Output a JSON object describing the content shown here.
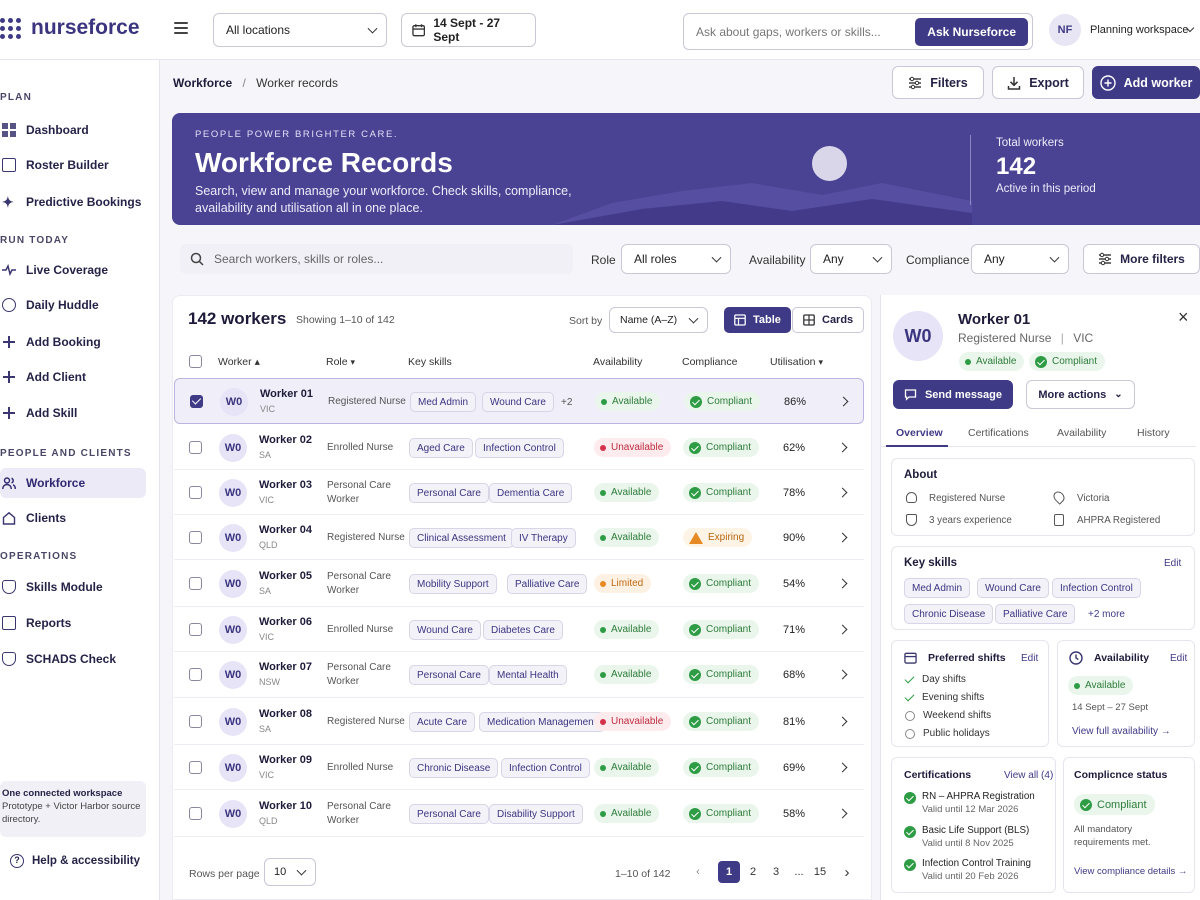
{
  "app": {
    "brand": "nurseforce",
    "workspace": "Planning workspace",
    "avatar": "NF"
  },
  "topbar": {
    "location": "All locations",
    "date_range": "14 Sept - 27 Sept",
    "ask_placeholder": "Ask about gaps, workers or skills...",
    "ask_button": "Ask Nurseforce"
  },
  "sidebar": {
    "sections": [
      {
        "title": "PLAN",
        "items": [
          "Dashboard",
          "Roster Builder",
          "Predictive Bookings"
        ]
      },
      {
        "title": "RUN TODAY",
        "items": [
          "Live Coverage",
          "Daily Huddle",
          "Add Booking",
          "Add Client",
          "Add Skill"
        ]
      },
      {
        "title": "PEOPLE AND CLIENTS",
        "items": [
          "Workforce",
          "Clients"
        ]
      },
      {
        "title": "OPERATIONS",
        "items": [
          "Skills Module",
          "Reports",
          "SCHADS Check"
        ]
      }
    ],
    "note_title": "One connected workspace",
    "note_body": "Prototype + Victor Harbor source directory.",
    "help": "Help & accessibility"
  },
  "breadcrumb": {
    "parent": "Workforce",
    "sep": "/",
    "current": "Worker records"
  },
  "actions": {
    "filters": "Filters",
    "export": "Export",
    "add": "Add worker"
  },
  "hero": {
    "tag": "PEOPLE POWER BRIGHTER CARE.",
    "title": "Workforce Records",
    "desc": "Search, view and manage your workforce. Check skills, compliance, availability and utilisation all in one place.",
    "total_label": "Total workers",
    "total": "142",
    "total_sub": "Active in this period"
  },
  "filters": {
    "search_placeholder": "Search workers, skills or roles...",
    "role_label": "Role",
    "role_value": "All roles",
    "avail_label": "Availability",
    "avail_value": "Any",
    "comp_label": "Compliance",
    "comp_value": "Any",
    "more": "More filters"
  },
  "table": {
    "title": "142 workers",
    "showing": "Showing 1–10 of 142",
    "sort_label": "Sort by",
    "sort_value": "Name (A–Z)",
    "view_table": "Table",
    "view_cards": "Cards",
    "columns": [
      "Worker",
      "Role",
      "Key skills",
      "Availability",
      "Compliance",
      "Utilisation"
    ],
    "rows": [
      {
        "initials": "W0",
        "name": "Worker 01",
        "state": "VIC",
        "role": "Registered Nurse",
        "skills": [
          "Med Admin",
          "Wound Care"
        ],
        "extra": "+2",
        "avail": "Available",
        "comp": "Compliant",
        "util": "86%"
      },
      {
        "initials": "W0",
        "name": "Worker 02",
        "state": "SA",
        "role": "Enrolled Nurse",
        "skills": [
          "Aged Care",
          "Infection Control"
        ],
        "avail": "Unavailable",
        "comp": "Compliant",
        "util": "62%"
      },
      {
        "initials": "W0",
        "name": "Worker 03",
        "state": "VIC",
        "role": "Personal Care Worker",
        "skills": [
          "Personal Care",
          "Dementia Care"
        ],
        "avail": "Available",
        "comp": "Compliant",
        "util": "78%"
      },
      {
        "initials": "W0",
        "name": "Worker 04",
        "state": "QLD",
        "role": "Registered Nurse",
        "skills": [
          "Clinical Assessment",
          "IV Therapy"
        ],
        "avail": "Available",
        "comp": "Expiring",
        "util": "90%"
      },
      {
        "initials": "W0",
        "name": "Worker 05",
        "state": "SA",
        "role": "Personal Care Worker",
        "skills": [
          "Mobility Support",
          "Palliative Care"
        ],
        "avail": "Limited",
        "comp": "Compliant",
        "util": "54%"
      },
      {
        "initials": "W0",
        "name": "Worker 06",
        "state": "VIC",
        "role": "Enrolled Nurse",
        "skills": [
          "Wound Care",
          "Diabetes Care"
        ],
        "avail": "Available",
        "comp": "Compliant",
        "util": "71%"
      },
      {
        "initials": "W0",
        "name": "Worker 07",
        "state": "NSW",
        "role": "Personal Care Worker",
        "skills": [
          "Personal Care",
          "Mental Health"
        ],
        "avail": "Available",
        "comp": "Compliant",
        "util": "68%"
      },
      {
        "initials": "W0",
        "name": "Worker 08",
        "state": "SA",
        "role": "Registered Nurse",
        "skills": [
          "Acute Care",
          "Medication Management"
        ],
        "avail": "Unavailable",
        "comp": "Compliant",
        "util": "81%"
      },
      {
        "initials": "W0",
        "name": "Worker 09",
        "state": "VIC",
        "role": "Enrolled Nurse",
        "skills": [
          "Chronic Disease",
          "Infection Control"
        ],
        "avail": "Available",
        "comp": "Compliant",
        "util": "69%"
      },
      {
        "initials": "W0",
        "name": "Worker 10",
        "state": "QLD",
        "role": "Personal Care Worker",
        "skills": [
          "Personal Care",
          "Disability Support"
        ],
        "avail": "Available",
        "comp": "Compliant",
        "util": "58%"
      }
    ],
    "rows_per_page_label": "Rows per page",
    "rows_per_page": "10",
    "range": "1–10 of 142",
    "pages": [
      "1",
      "2",
      "3",
      "...",
      "15"
    ]
  },
  "detail": {
    "initials": "W0",
    "name": "Worker 01",
    "role": "Registered Nurse",
    "sep": "|",
    "state": "VIC",
    "avail": "Available",
    "comp": "Compliant",
    "send": "Send message",
    "more": "More actions",
    "tabs": [
      "Overview",
      "Certifications",
      "Availability",
      "History"
    ],
    "about_title": "About",
    "about": {
      "role": "Registered Nurse",
      "location": "Victoria",
      "experience": "3 years experience",
      "reg": "AHPRA Registered"
    },
    "skills_title": "Key skills",
    "edit": "Edit",
    "skills": [
      "Med Admin",
      "Wound Care",
      "Infection Control",
      "Chronic Disease",
      "Palliative Care"
    ],
    "skills_more": "+2 more",
    "pref_title": "Preferred shifts",
    "pref": [
      {
        "label": "Day shifts",
        "on": true
      },
      {
        "label": "Evening shifts",
        "on": true
      },
      {
        "label": "Weekend shifts",
        "on": false
      },
      {
        "label": "Public holidays",
        "on": false
      }
    ],
    "avail_title": "Availability",
    "avail_status": "Available",
    "avail_range": "14 Sept – 27 Sept",
    "avail_link": "View full availability",
    "cert_title": "Certifications",
    "cert_link": "View all (4)",
    "certs": [
      {
        "name": "RN – AHPRA Registration",
        "valid": "Valid until 12 Mar 2026"
      },
      {
        "name": "Basic Life Support (BLS)",
        "valid": "Valid until 8 Nov 2025"
      },
      {
        "name": "Infection Control Training",
        "valid": "Valid until 20 Feb 2026"
      }
    ],
    "comp_title": "Complicnce status",
    "comp_status": "Compliant",
    "comp_note": "All mandatory requirements met.",
    "comp_link": "View compliance details"
  }
}
